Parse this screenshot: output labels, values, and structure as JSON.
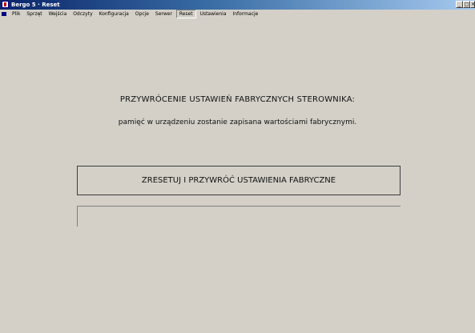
{
  "window": {
    "title": "Bergo 5 · Reset"
  },
  "menu": {
    "items": [
      {
        "label": "Plik"
      },
      {
        "label": "Sprzęt"
      },
      {
        "label": "Wejścia"
      },
      {
        "label": "Odczyty"
      },
      {
        "label": "Konfiguracja"
      },
      {
        "label": "Opcje"
      },
      {
        "label": "Serwer"
      },
      {
        "label": "Reset",
        "active": true
      },
      {
        "label": "Ustawienia"
      },
      {
        "label": "Informacje"
      }
    ]
  },
  "main": {
    "heading": "PRZYWRÓCENIE USTAWIEŃ FABRYCZNYCH STEROWNIKA:",
    "subheading": "pamięć w urządzeniu zostanie zapisana wartościami fabrycznymi.",
    "reset_button_label": "ZRESETUJ I PRZYWRÓĆ USTAWIENIA FABRYCZNE",
    "status_text": ""
  }
}
